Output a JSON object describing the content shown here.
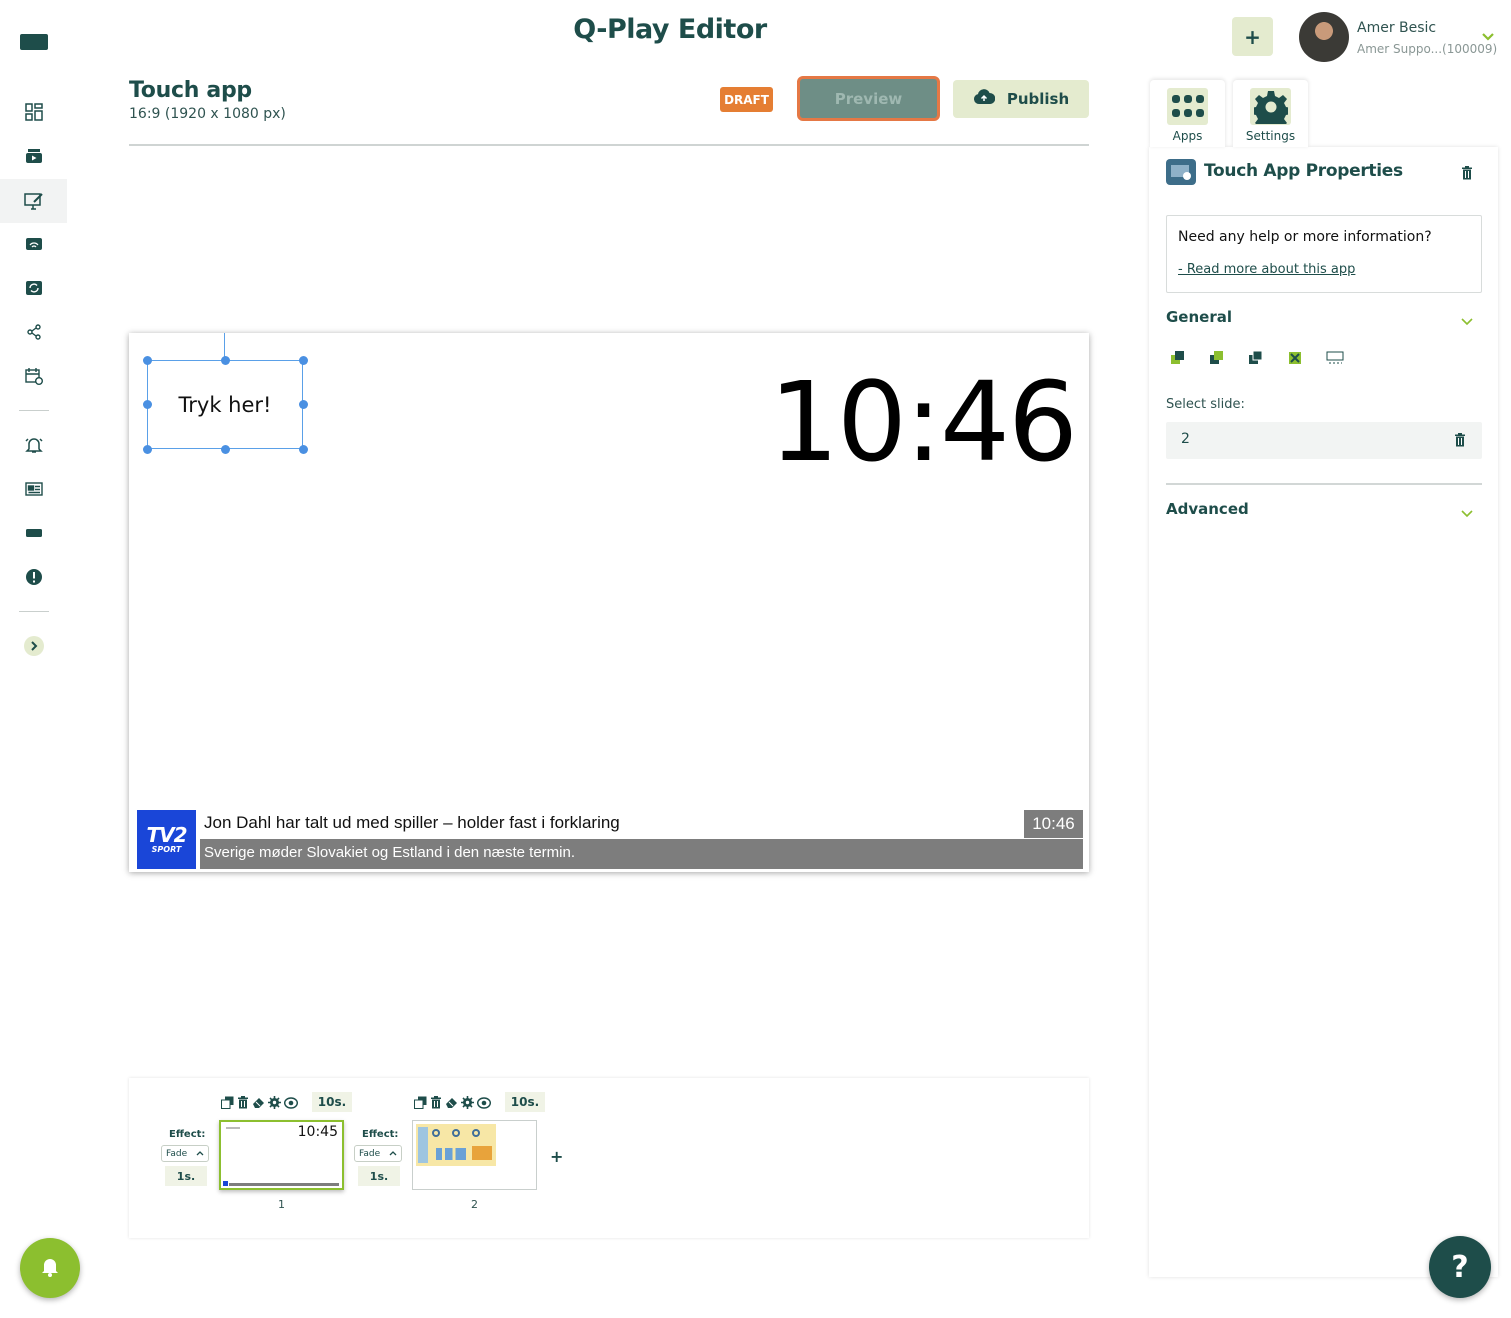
{
  "header": {
    "title": "Q-Play Editor",
    "add_label": "+",
    "user": {
      "name": "Amer Besic",
      "account": "Amer Suppo...(100009)"
    }
  },
  "sidebar": {
    "items": [
      {
        "icon": "logo-icon"
      },
      {
        "icon": "dashboard-icon"
      },
      {
        "icon": "media-icon"
      },
      {
        "icon": "editor-icon",
        "active": true
      },
      {
        "icon": "screens-icon"
      },
      {
        "icon": "playlist-icon"
      },
      {
        "icon": "share-icon"
      },
      {
        "icon": "schedule-icon"
      },
      {
        "icon": "alarm-icon"
      },
      {
        "icon": "news-icon"
      },
      {
        "icon": "device-icon"
      },
      {
        "icon": "alert-icon"
      },
      {
        "icon": "expand-icon"
      }
    ]
  },
  "document": {
    "title": "Touch app",
    "resolution": "16:9 (1920 x 1080 px)",
    "status": "DRAFT",
    "preview_label": "Preview",
    "publish_label": "Publish"
  },
  "canvas": {
    "touch_text": "Tryk her!",
    "clock": "10:46",
    "ticker": {
      "logo_top": "TV2",
      "logo_bottom": "SPORT",
      "headline": "Jon Dahl har talt ud med spiller – holder fast i forklaring",
      "time": "10:46",
      "subline": "Sverige møder Slovakiet og Estland i den næste termin."
    }
  },
  "slides": [
    {
      "number": "1",
      "duration": "10s.",
      "effect_label": "Effect:",
      "effect": "Fade",
      "effect_duration": "1s.",
      "thumb_clock": "10:45",
      "selected": true
    },
    {
      "number": "2",
      "duration": "10s.",
      "effect_label": "Effect:",
      "effect": "Fade",
      "effect_duration": "1s.",
      "selected": false
    }
  ],
  "add_slide_label": "+",
  "panel": {
    "tabs": [
      {
        "label": "Apps",
        "icon": "apps-grid-icon"
      },
      {
        "label": "Settings",
        "icon": "gear-icon"
      }
    ],
    "title": "Touch App Properties",
    "help_question": "Need any help or more information?",
    "help_link": "- Read more about this app",
    "general_label": "General",
    "select_slide_label": "Select slide:",
    "select_slide_value": "2",
    "advanced_label": "Advanced"
  },
  "fab": {
    "help_label": "?"
  },
  "colors": {
    "primary": "#1e4d4a",
    "accent_light": "#e4ebcf",
    "draft": "#e57e33",
    "green": "#8cbf2f"
  }
}
